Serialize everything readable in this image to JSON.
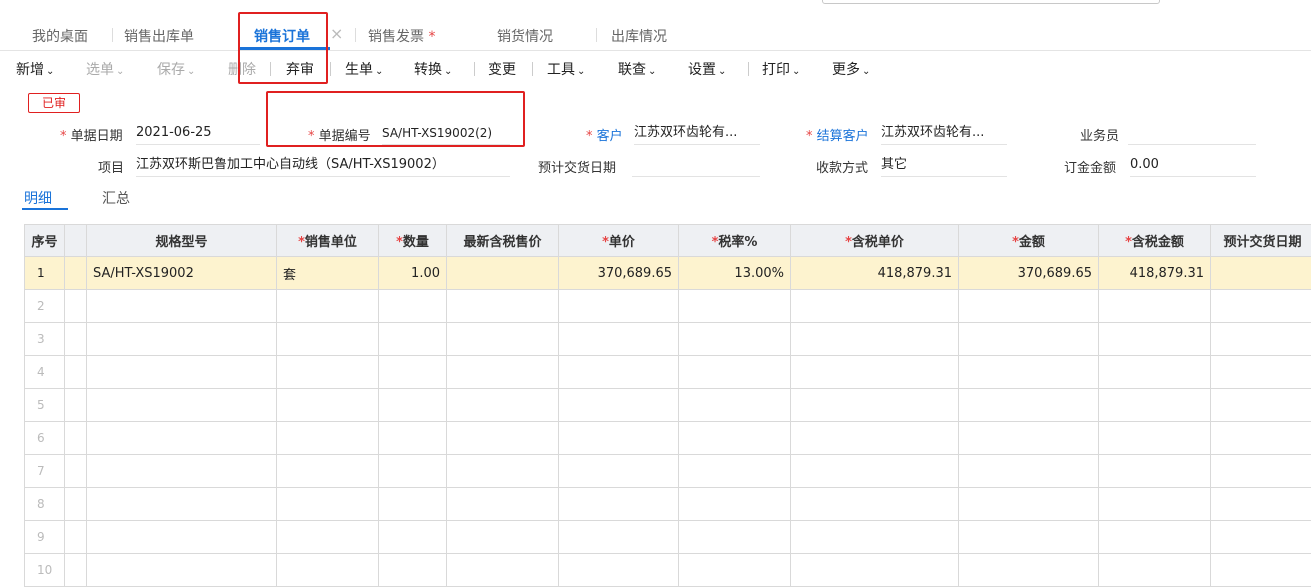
{
  "tabs": [
    {
      "label": "我的桌面",
      "active": false,
      "required": false
    },
    {
      "label": "销售出库单",
      "active": false,
      "required": false
    },
    {
      "label": "销售订单",
      "active": true,
      "required": false
    },
    {
      "label": "销售发票",
      "active": false,
      "required": true
    },
    {
      "label": "销货情况",
      "active": false,
      "required": false
    },
    {
      "label": "出库情况",
      "active": false,
      "required": false
    }
  ],
  "close_glyph": "×",
  "required_mark": "*",
  "toolbar": {
    "add": "新增",
    "select": "选单",
    "save": "保存",
    "delete": "删除",
    "abandon": "弃审",
    "generate": "生单",
    "convert": "转换",
    "change": "变更",
    "tools": "工具",
    "query": "联查",
    "settings": "设置",
    "print": "打印",
    "more": "更多",
    "caret": "⌄"
  },
  "status_badge": "已审",
  "form": {
    "date_label": "单据日期",
    "date_value": "2021-06-25",
    "code_label": "单据编号",
    "code_value": "SA/HT-XS19002(2)",
    "customer_label": "客户",
    "customer_value": "江苏双环齿轮有...",
    "settle_label": "结算客户",
    "settle_value": "江苏双环齿轮有...",
    "salesman_label": "业务员",
    "salesman_value": "",
    "project_label": "项目",
    "project_value": "江苏双环斯巴鲁加工中心自动线（SA/HT-XS19002）",
    "delivery_label": "预计交货日期",
    "delivery_value": "",
    "payment_label": "收款方式",
    "payment_value": "其它",
    "deposit_label": "订金金额",
    "deposit_value": "0.00"
  },
  "subtabs": {
    "detail": "明细",
    "summary": "汇总"
  },
  "grid": {
    "headers": {
      "idx": "序号",
      "spec": "规格型号",
      "unit": "销售单位",
      "qty": "数量",
      "latest": "最新含税售价",
      "price": "单价",
      "tax": "税率%",
      "taxprice": "含税单价",
      "amount": "金额",
      "taxamount": "含税金额",
      "delivery": "预计交货日期"
    },
    "rows": [
      {
        "idx": "1",
        "spec": "SA/HT-XS19002",
        "unit": "套",
        "qty": "1.00",
        "latest": "",
        "price": "370,689.65",
        "tax": "13.00%",
        "taxprice": "418,879.31",
        "amount": "370,689.65",
        "taxamount": "418,879.31",
        "delivery": ""
      },
      {
        "idx": "2"
      },
      {
        "idx": "3"
      },
      {
        "idx": "4"
      },
      {
        "idx": "5"
      },
      {
        "idx": "6"
      },
      {
        "idx": "7"
      },
      {
        "idx": "8"
      },
      {
        "idx": "9"
      },
      {
        "idx": "10"
      }
    ]
  }
}
